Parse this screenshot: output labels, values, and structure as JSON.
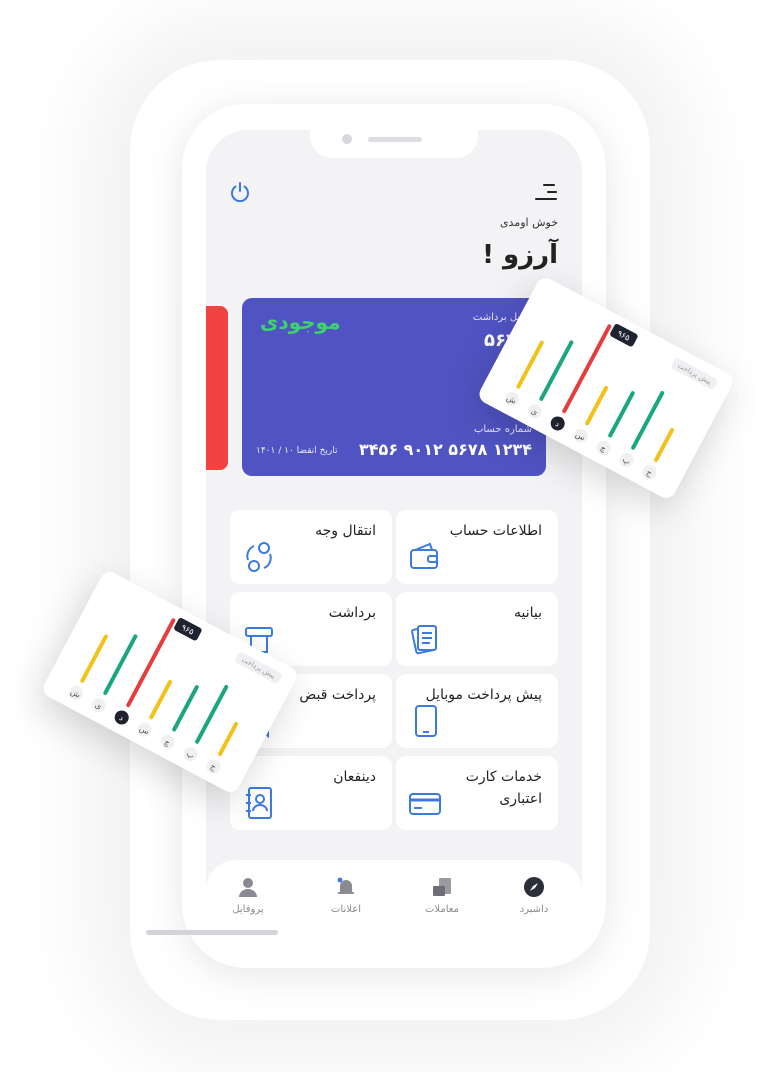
{
  "header": {
    "welcome": "خوش اومدی",
    "username": "آرزو !"
  },
  "card": {
    "brand": "موجودی",
    "withdrawable_label": "قابل برداشت",
    "withdrawable_value": "۵۶۴۰",
    "account_label": "شماره حساب",
    "account_number": "۱۲۳۴ ۵۶۷۸ ۹۰۱۲ ۳۴۵۶",
    "expiry": "تاریخ انقضا ۱۰ / ۱۴۰۱"
  },
  "services": [
    {
      "label": "اطلاعات حساب",
      "icon": "wallet-icon"
    },
    {
      "label": "انتقال وجه",
      "icon": "transfer-icon"
    },
    {
      "label": "بیانیه",
      "icon": "statement-icon"
    },
    {
      "label": "برداشت",
      "icon": "withdraw-icon"
    },
    {
      "label": "پیش پرداخت موبایل",
      "icon": "mobile-icon"
    },
    {
      "label": "پرداخت قبض",
      "icon": "bill-icon"
    },
    {
      "label": "خدمات کارت اعتباری",
      "icon": "credit-card-icon"
    },
    {
      "label": "دینفعان",
      "icon": "contacts-icon"
    }
  ],
  "tabs": [
    {
      "label": "داشبرد",
      "icon": "compass-icon",
      "active": true
    },
    {
      "label": "معاملات",
      "icon": "transactions-icon",
      "active": false
    },
    {
      "label": "اعلانات",
      "icon": "bell-icon",
      "active": false
    },
    {
      "label": "پروفایل",
      "icon": "user-icon",
      "active": false
    }
  ],
  "widget": {
    "label": "پیش پرداخت",
    "tooltip": "۹۶۵",
    "days": [
      "ش",
      "ی",
      "د",
      "س",
      "چ",
      "پ",
      "ج"
    ],
    "active_day_index": 2
  },
  "colors": {
    "card": "#5054c3",
    "accent_green": "#3dd36b",
    "accent_red": "#f24343",
    "icon_blue": "#3b7be0",
    "bar_yellow": "#f2c21a",
    "bar_teal": "#1aa67e",
    "bar_red": "#e53d3d"
  }
}
